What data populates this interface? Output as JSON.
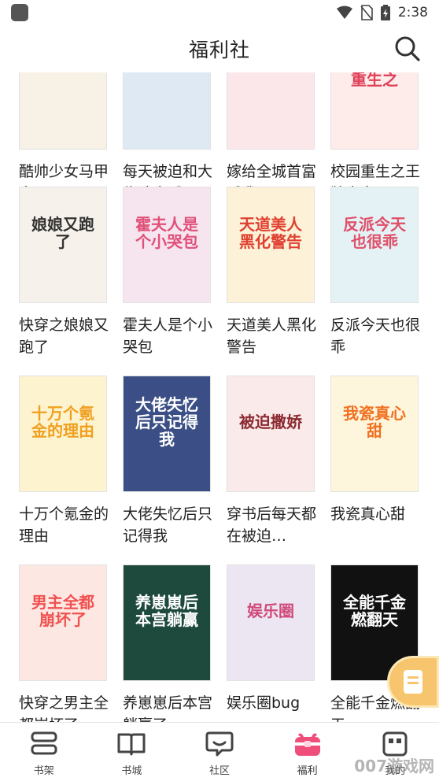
{
  "status_bar": {
    "time": "2:38"
  },
  "header": {
    "title": "福利社",
    "search_icon": "search-icon"
  },
  "books": [
    {
      "title": "酷帅少女马甲多",
      "cover_bg": "#f7f1e6",
      "cover_text": "",
      "accent": "#c04040"
    },
    {
      "title": "每天被迫和大佬谈恋爱",
      "cover_bg": "#dfe9f4",
      "cover_text": "",
      "accent": "#6a8bb0"
    },
    {
      "title": "嫁给全城首富后我飘了",
      "cover_bg": "#fbe6ea",
      "cover_text": "",
      "accent": "#d0506a"
    },
    {
      "title": "校园重生之王牌少女",
      "cover_bg": "#fdecea",
      "cover_text": "重生之",
      "accent": "#e0405a"
    },
    {
      "title": "快穿之娘娘又跑了",
      "cover_bg": "#f6f1ea",
      "cover_text": "娘娘又跑了",
      "accent": "#333333"
    },
    {
      "title": "霍夫人是个小哭包",
      "cover_bg": "#f6e4ee",
      "cover_text": "霍夫人是个小哭包",
      "accent": "#e0507a"
    },
    {
      "title": "天道美人黑化警告",
      "cover_bg": "#fdf2d8",
      "cover_text": "天道美人黑化警告",
      "accent": "#e04030"
    },
    {
      "title": "反派今天也很乖",
      "cover_bg": "#e4f2f6",
      "cover_text": "反派今天也很乖",
      "accent": "#e0506a"
    },
    {
      "title": "十万个氪金的理由",
      "cover_bg": "#fdf3cf",
      "cover_text": "十万个氪金的理由",
      "accent": "#f0a020"
    },
    {
      "title": "大佬失忆后只记得我",
      "cover_bg": "#3b4f86",
      "cover_text": "大佬失忆后只记得我",
      "accent": "#ffffff"
    },
    {
      "title": "穿书后每天都在被迫…",
      "cover_bg": "#fbeaea",
      "cover_text": "被迫撒娇",
      "accent": "#8a2a30"
    },
    {
      "title": "我瓷真心甜",
      "cover_bg": "#fdf6dc",
      "cover_text": "我瓷真心甜",
      "accent": "#f07020"
    },
    {
      "title": "快穿之男主全都崩坏了",
      "cover_bg": "#fde7e2",
      "cover_text": "男主全都崩坏了",
      "accent": "#f05050"
    },
    {
      "title": "养崽崽后本宫躺赢了",
      "cover_bg": "#1e4a3e",
      "cover_text": "养崽崽后本宫躺赢",
      "accent": "#ffffff"
    },
    {
      "title": "娱乐圈bug",
      "cover_bg": "#ece6f2",
      "cover_text": "娱乐圈",
      "accent": "#d04a7a"
    },
    {
      "title": "全能千金燃翻天",
      "cover_bg": "#111111",
      "cover_text": "全能千金燃翻天",
      "accent": "#ffffff"
    }
  ],
  "tabs": [
    {
      "label": "书架",
      "icon": "bookshelf-icon"
    },
    {
      "label": "书城",
      "icon": "open-book-icon"
    },
    {
      "label": "社区",
      "icon": "chat-bubble-icon"
    },
    {
      "label": "福利",
      "icon": "gift-box-icon"
    },
    {
      "label": "我的",
      "icon": "profile-icon"
    }
  ],
  "active_tab": "福利",
  "accent_color": "#f04e7a",
  "watermark": "007游戏网"
}
